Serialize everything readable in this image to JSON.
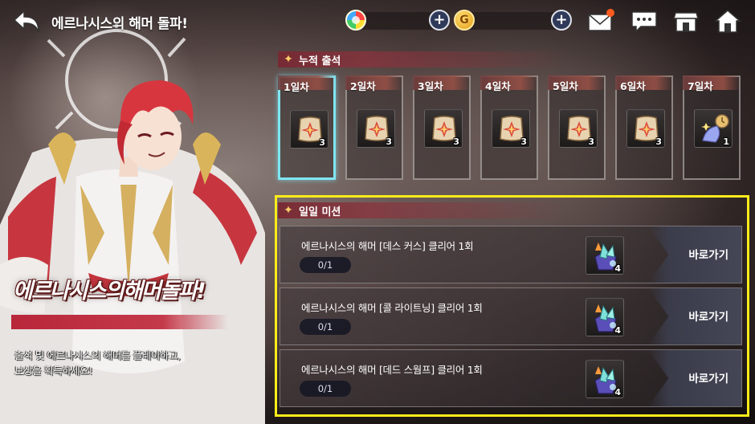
{
  "header": {
    "title": "에르나시스의 해머 돌파!",
    "currency_1": {
      "icon": "rainbow-gem-icon"
    },
    "currency_2": {
      "icon": "gold-coin-icon",
      "symbol": "G"
    },
    "icons": [
      "back-arrow-icon",
      "mail-icon",
      "chat-icon",
      "shop-icon",
      "home-icon"
    ]
  },
  "attendance": {
    "section_label": "누적 출석",
    "days": [
      {
        "label": "1일차",
        "count": "3",
        "icon": "scroll-ticket-icon",
        "active": true
      },
      {
        "label": "2일차",
        "count": "3",
        "icon": "scroll-ticket-icon",
        "active": false
      },
      {
        "label": "3일차",
        "count": "3",
        "icon": "scroll-ticket-icon",
        "active": false
      },
      {
        "label": "4일차",
        "count": "3",
        "icon": "scroll-ticket-icon",
        "active": false
      },
      {
        "label": "5일차",
        "count": "3",
        "icon": "scroll-ticket-icon",
        "active": false
      },
      {
        "label": "6일차",
        "count": "3",
        "icon": "scroll-ticket-icon",
        "active": false
      },
      {
        "label": "7일차",
        "count": "1",
        "icon": "magic-hourglass-icon",
        "active": false
      }
    ]
  },
  "missions": {
    "section_label": "일일 미션",
    "items": [
      {
        "title": "에르나시스의 해머 [데스 커스] 클리어 1회",
        "progress": "0/1",
        "reward_count": "4",
        "button": "바로가기"
      },
      {
        "title": "에르나시스의 해머 [콜 라이트닝] 클리어 1회",
        "progress": "0/1",
        "reward_count": "4",
        "button": "바로가기"
      },
      {
        "title": "에르나시스의 해머 [데드 스웜프] 클리어 1회",
        "progress": "0/1",
        "reward_count": "4",
        "button": "바로가기"
      }
    ]
  },
  "banner": {
    "title": "에르나시스의해머돌파!",
    "description_line1": "출석 및 에르나시스의 해머를 플레이하고,",
    "description_line2": "보상을 획득하세요!"
  },
  "colors": {
    "highlight_frame": "#ffec1a",
    "active_day_border": "#7fe6f3",
    "section_header": "#8c323c",
    "banner_bar": "#b8263a"
  }
}
